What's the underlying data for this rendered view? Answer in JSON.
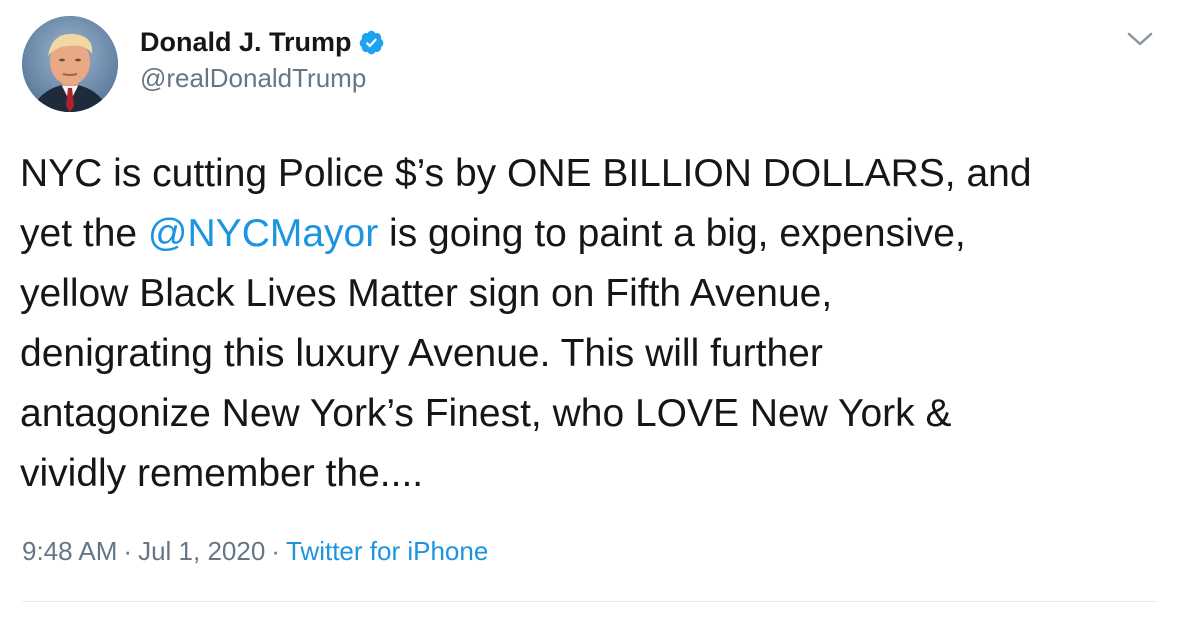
{
  "user": {
    "display_name": "Donald J. Trump",
    "handle": "@realDonaldTrump",
    "verified": true
  },
  "tweet": {
    "lines": [
      [
        "NYC is cutting Police $’s by ONE BILLION DOLLARS, and"
      ],
      [
        "yet the ",
        "@NYCMayor",
        " is going to paint a big, expensive,"
      ],
      [
        "yellow Black Lives Matter sign on Fifth Avenue,"
      ],
      [
        "denigrating this luxury Avenue. This will further"
      ],
      [
        "antagonize New York’s Finest, who LOVE New York &"
      ],
      [
        "vividly remember the...."
      ]
    ]
  },
  "meta": {
    "time": "9:48 AM",
    "separator": "·",
    "date": "Jul 1, 2020",
    "source": "Twitter for iPhone"
  },
  "colors": {
    "link": "#1b95e0",
    "secondary_text": "#657786",
    "verified": "#1da1f2"
  },
  "icons": {
    "verified": "verified-badge-icon",
    "caret": "chevron-down-icon"
  }
}
